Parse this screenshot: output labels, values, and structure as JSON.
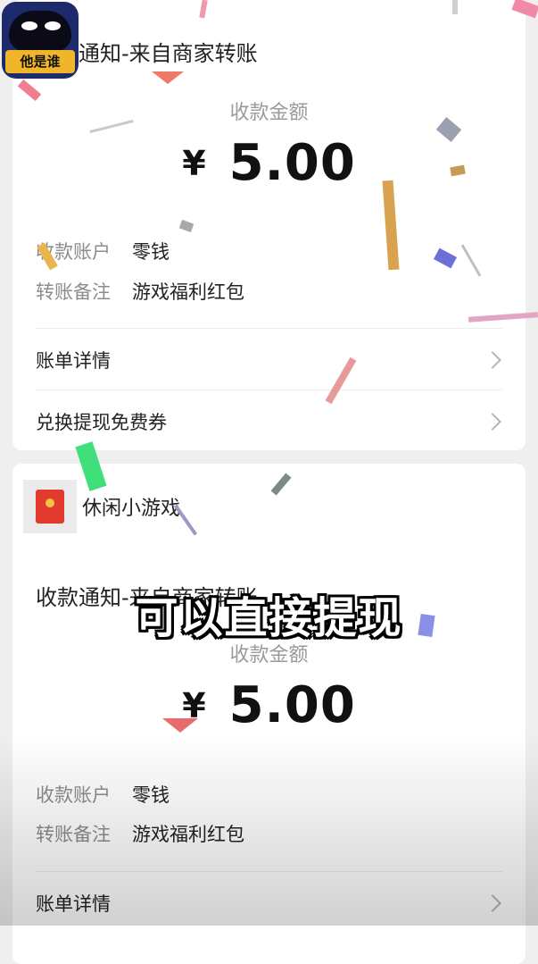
{
  "logo": {
    "text": "他是谁"
  },
  "card1": {
    "title": "收款通知-来自商家转账",
    "amount_label": "收款金额",
    "currency": "¥",
    "amount": "5.00",
    "account_key": "收款账户",
    "account_value": "零钱",
    "note_key": "转账备注",
    "note_value": "游戏福利红包",
    "row1": "账单详情",
    "row2": "兑换提现免费券"
  },
  "card2": {
    "app_name": "休闲小游戏",
    "title": "收款通知-来自商家转账",
    "amount_label": "收款金额",
    "currency": "¥",
    "amount": "5.00",
    "account_key": "收款账户",
    "account_value": "零钱",
    "note_key": "转账备注",
    "note_value": "游戏福利红包",
    "row1": "账单详情"
  },
  "overlay": {
    "caption": "可以直接提现"
  },
  "colors": {
    "red_packet": "#e23b2d",
    "card_bg": "#ffffff",
    "page_bg": "#efefef"
  }
}
